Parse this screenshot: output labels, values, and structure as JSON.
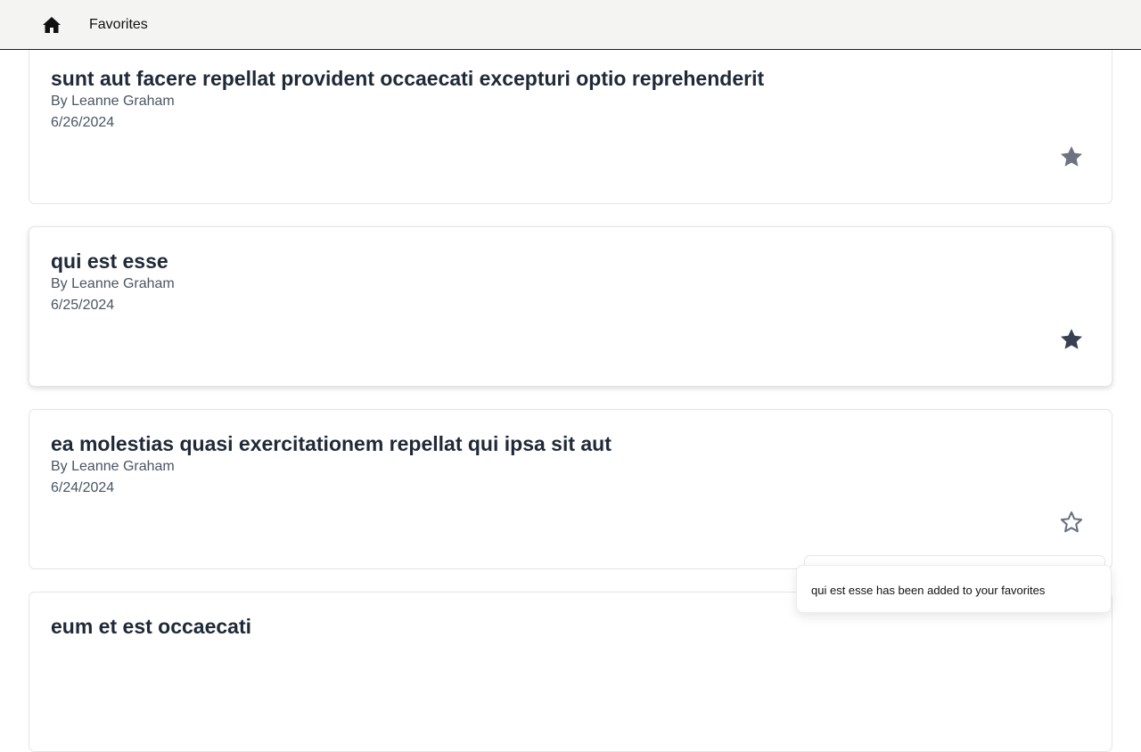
{
  "nav": {
    "home_icon": "home-icon",
    "favorites_label": "Favorites"
  },
  "posts": [
    {
      "title": "sunt aut facere repellat provident occaecati excepturi optio reprehenderit",
      "author": "By Leanne Graham",
      "date": "6/26/2024",
      "favorited": true,
      "star_color": "#6b7280"
    },
    {
      "title": "qui est esse",
      "author": "By Leanne Graham",
      "date": "6/25/2024",
      "favorited": true,
      "star_color": "#374151"
    },
    {
      "title": "ea molestias quasi exercitationem repellat qui ipsa sit aut",
      "author": "By Leanne Graham",
      "date": "6/24/2024",
      "favorited": false,
      "star_color": "#6b7280"
    },
    {
      "title": "eum et est occaecati",
      "author": "",
      "date": "",
      "favorited": false,
      "star_color": "#6b7280"
    }
  ],
  "toast": {
    "message": "qui est esse has been added to your favorites"
  }
}
